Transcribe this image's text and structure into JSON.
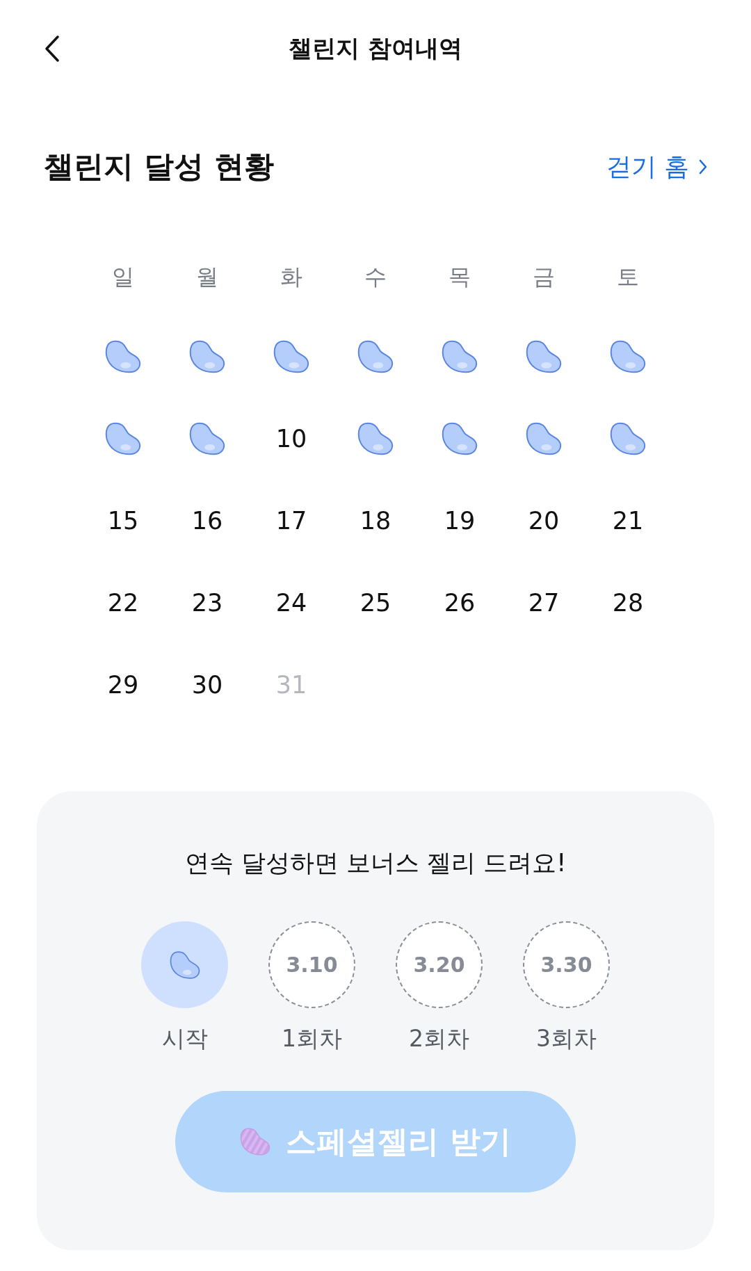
{
  "header": {
    "title": "챌린지 참여내역"
  },
  "section": {
    "title": "챌린지 달성 현황",
    "link": "걷기 홈"
  },
  "calendar": {
    "weekdays": [
      "일",
      "월",
      "화",
      "수",
      "목",
      "금",
      "토"
    ],
    "days": [
      {
        "achieved": true
      },
      {
        "achieved": true
      },
      {
        "achieved": true
      },
      {
        "achieved": true
      },
      {
        "achieved": true
      },
      {
        "achieved": true
      },
      {
        "achieved": true
      },
      {
        "achieved": true
      },
      {
        "achieved": true
      },
      {
        "achieved": false,
        "day": "10",
        "disabled": false
      },
      {
        "achieved": true
      },
      {
        "achieved": true
      },
      {
        "achieved": true
      },
      {
        "achieved": true
      },
      {
        "achieved": false,
        "day": "15",
        "disabled": false
      },
      {
        "achieved": false,
        "day": "16",
        "disabled": false
      },
      {
        "achieved": false,
        "day": "17",
        "disabled": false
      },
      {
        "achieved": false,
        "day": "18",
        "disabled": false
      },
      {
        "achieved": false,
        "day": "19",
        "disabled": false
      },
      {
        "achieved": false,
        "day": "20",
        "disabled": false
      },
      {
        "achieved": false,
        "day": "21",
        "disabled": false
      },
      {
        "achieved": false,
        "day": "22",
        "disabled": false
      },
      {
        "achieved": false,
        "day": "23",
        "disabled": false
      },
      {
        "achieved": false,
        "day": "24",
        "disabled": false
      },
      {
        "achieved": false,
        "day": "25",
        "disabled": false
      },
      {
        "achieved": false,
        "day": "26",
        "disabled": false
      },
      {
        "achieved": false,
        "day": "27",
        "disabled": false
      },
      {
        "achieved": false,
        "day": "28",
        "disabled": false
      },
      {
        "achieved": false,
        "day": "29",
        "disabled": false
      },
      {
        "achieved": false,
        "day": "30",
        "disabled": false
      },
      {
        "achieved": false,
        "day": "31",
        "disabled": true
      }
    ]
  },
  "bonus": {
    "message": "연속 달성하면 보너스 젤리 드려요!",
    "milestones": [
      {
        "kind": "start",
        "achieved": true,
        "label": "시작"
      },
      {
        "kind": "date",
        "achieved": false,
        "date": "3.10",
        "label": "1회차"
      },
      {
        "kind": "date",
        "achieved": false,
        "date": "3.20",
        "label": "2회차"
      },
      {
        "kind": "date",
        "achieved": false,
        "date": "3.30",
        "label": "3회차"
      }
    ],
    "button": {
      "label": "스페셜젤리 받기",
      "disabled": true
    }
  }
}
